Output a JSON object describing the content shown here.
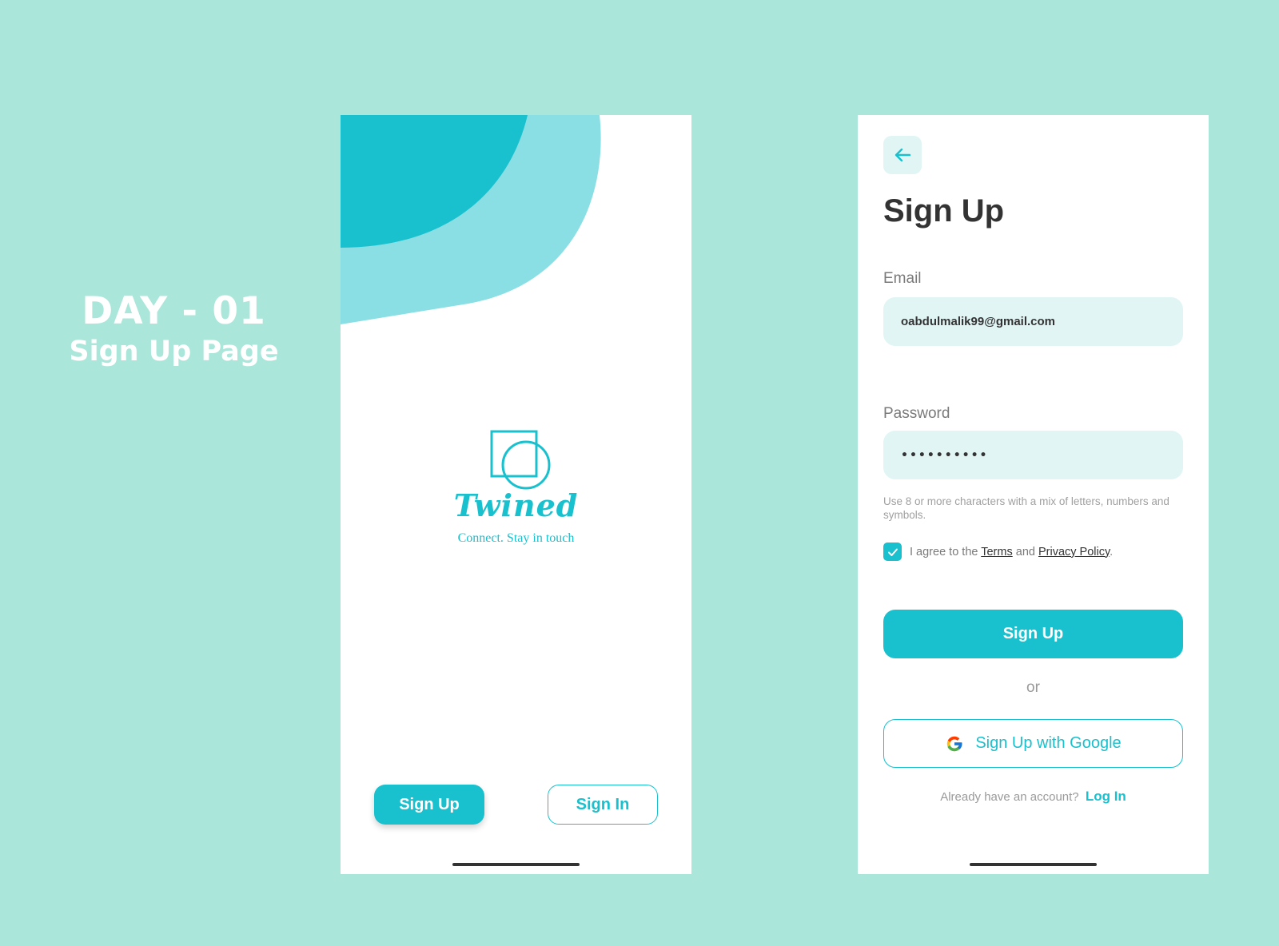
{
  "banner": {
    "day": "DAY - 01",
    "subtitle": "Sign Up Page"
  },
  "welcome_screen": {
    "brand_name": "Twined",
    "tagline": "Connect. Stay in touch",
    "sign_up_label": "Sign Up",
    "sign_in_label": "Sign In"
  },
  "signup_screen": {
    "back_icon": "arrow-left-icon",
    "title": "Sign Up",
    "email_label": "Email",
    "email_value": "oabdulmalik99@gmail.com",
    "password_label": "Password",
    "password_value": "••••••••••",
    "password_hint": "Use 8 or more characters with a mix of letters, numbers and symbols.",
    "agree_checked": true,
    "agree_prefix": "I agree to the",
    "terms_label": "Terms",
    "agree_and": "and",
    "privacy_label": "Privacy Policy",
    "agree_suffix": ".",
    "submit_label": "Sign Up",
    "or_label": "or",
    "google_label": "Sign Up with Google",
    "google_icon": "google-icon",
    "have_account_label": "Already have an account?",
    "login_label": "Log In"
  },
  "colors": {
    "background": "#abe6da",
    "accent": "#19c0cd",
    "accent_light": "#8adfe4",
    "field_bg": "#e1f5f5",
    "text_dark": "#333333"
  }
}
